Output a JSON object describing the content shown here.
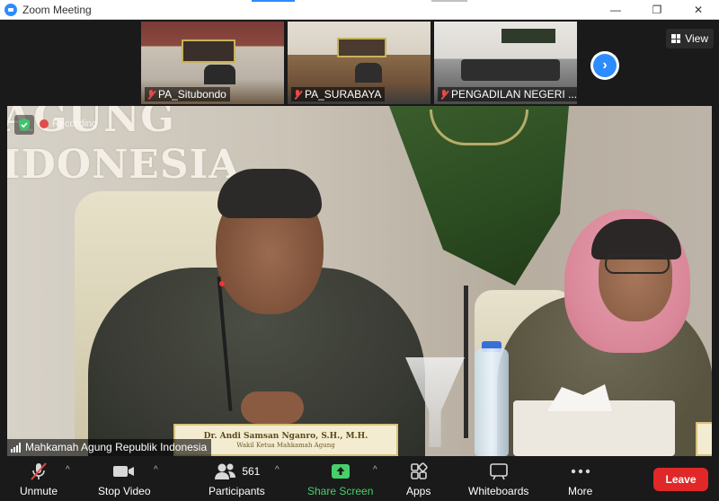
{
  "window": {
    "title": "Zoom Meeting",
    "controls": {
      "minimize": "—",
      "restore": "❐",
      "close": "✕"
    }
  },
  "gallery": {
    "tiles": [
      {
        "name": "PA_Situbondo",
        "muted": true
      },
      {
        "name": "PA_SURABAYA",
        "muted": true
      },
      {
        "name": "PENGADILAN NEGERI ...",
        "muted": true
      }
    ],
    "view_label": "View",
    "next_icon": "chevron-right"
  },
  "main_video": {
    "speaker_name": "Mahkamah Agung Republik Indonesia",
    "wall_text_line1": "AGUNG",
    "wall_text_line2": "IDONESIA",
    "nameplate_name": "Dr. Andi Samsan Nganro, S.H., M.H.",
    "nameplate_title": "Wakil Ketua Mahkamah Agung",
    "recording_label": "Recording"
  },
  "toolbar": {
    "unmute": "Unmute",
    "stop_video": "Stop Video",
    "participants": "Participants",
    "participants_count": "561",
    "share_screen": "Share Screen",
    "apps": "Apps",
    "whiteboards": "Whiteboards",
    "more": "More",
    "leave": "Leave"
  },
  "colors": {
    "accent": "#2d8cff",
    "share_green": "#45d16a",
    "leave_red": "#e02828",
    "mute_red": "#e24b4b"
  }
}
